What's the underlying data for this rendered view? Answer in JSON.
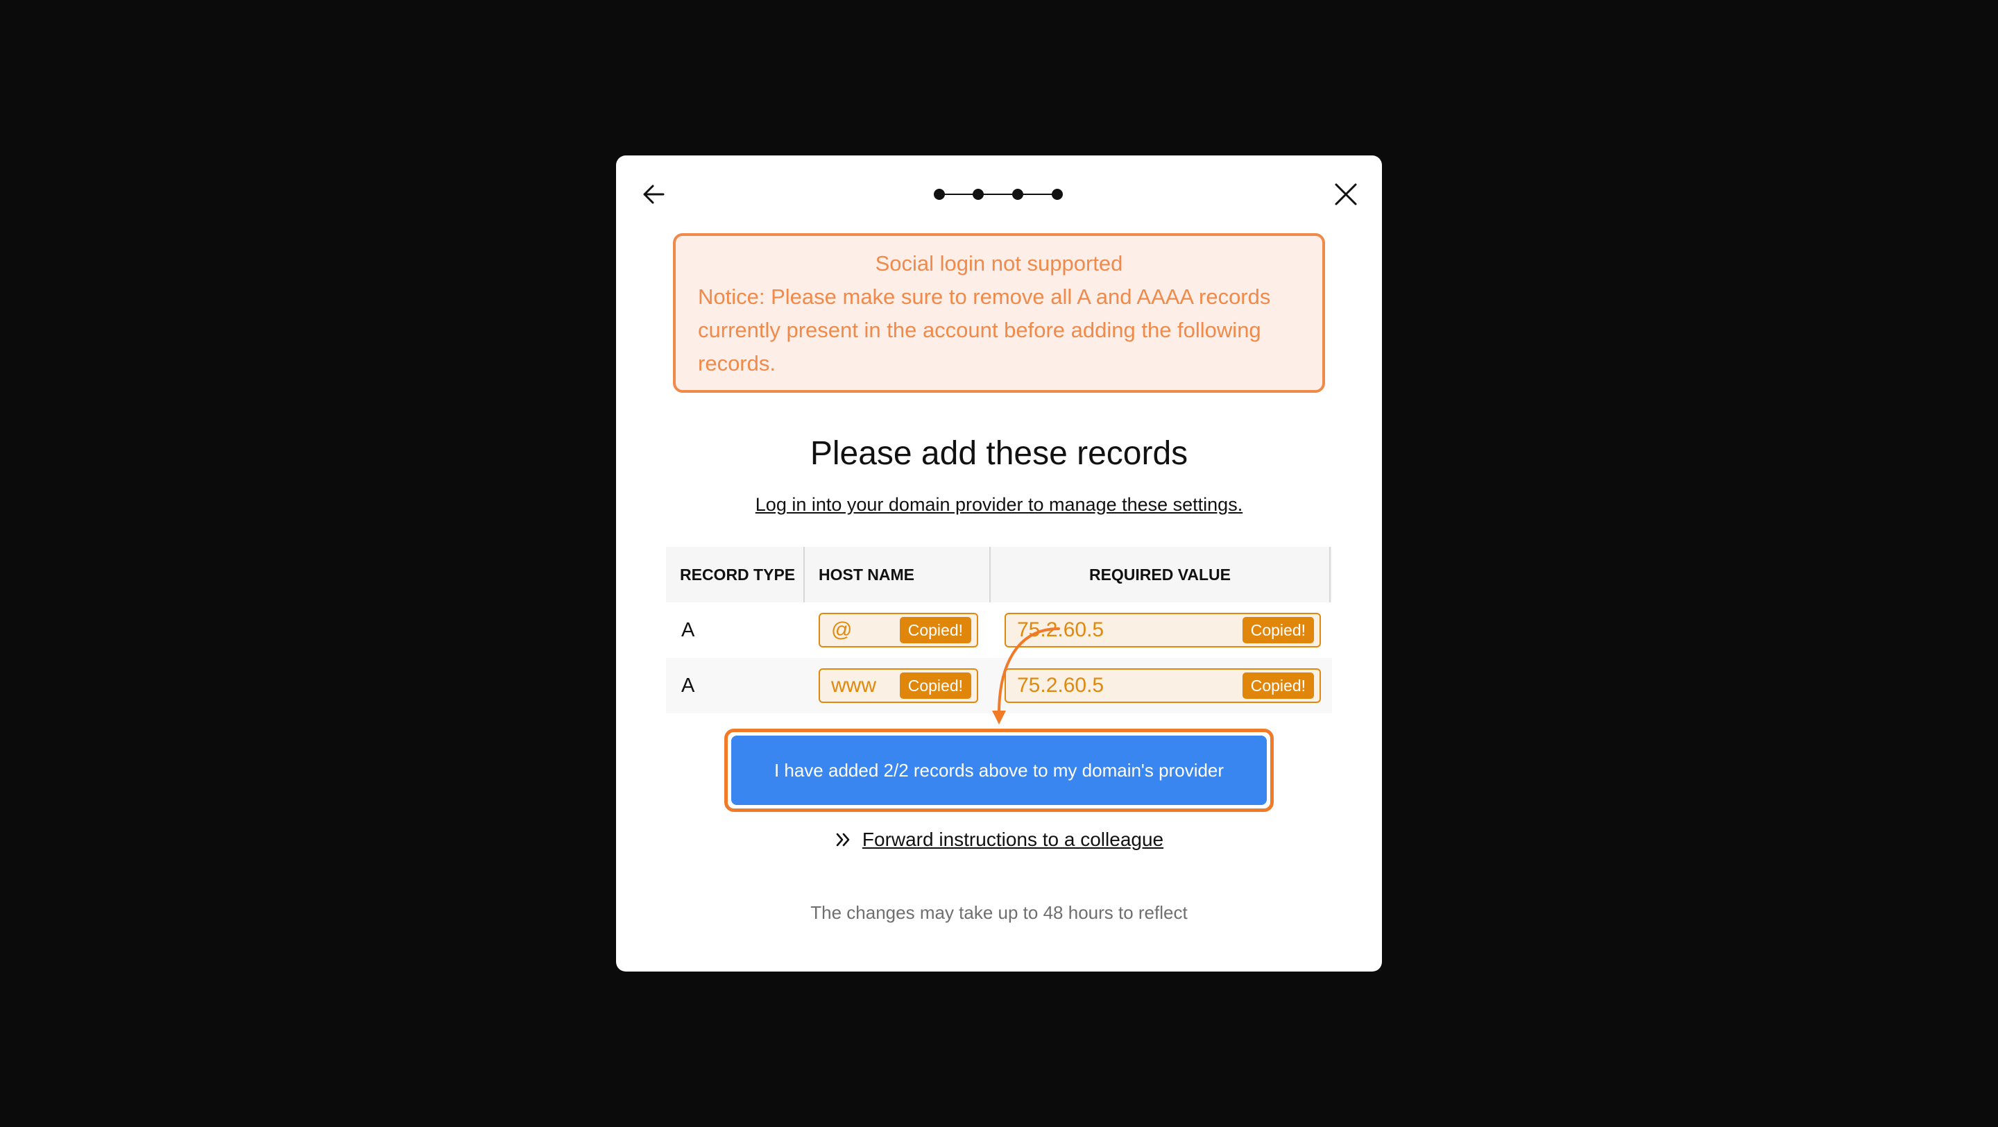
{
  "header": {
    "back_icon": "arrow-left-icon",
    "close_icon": "close-icon",
    "stepper_total": 4
  },
  "notice": {
    "title": "Social login not supported",
    "body": "Notice: Please make sure to remove all A and AAAA records currently present in the account before adding the following records.",
    "color": "#f08a4b",
    "background": "#fdeee7"
  },
  "main": {
    "heading": "Please add these records",
    "provider_link": "Log in into your domain provider to manage these settings."
  },
  "table": {
    "columns": [
      "RECORD TYPE",
      "HOST NAME",
      "REQUIRED VALUE"
    ],
    "rows": [
      {
        "type": "A",
        "host": "@",
        "host_badge": "Copied!",
        "value": "75.2.60.5",
        "value_badge": "Copied!"
      },
      {
        "type": "A",
        "host": "www",
        "host_badge": "Copied!",
        "value": "75.2.60.5",
        "value_badge": "Copied!"
      }
    ]
  },
  "actions": {
    "confirm_label": "I have added 2/2 records above to my domain's provider",
    "forward_icon": "double-chevron-right-icon",
    "forward_label": "Forward instructions to a colleague"
  },
  "footer": {
    "note": "The changes may take up to 48 hours to reflect"
  },
  "colors": {
    "page_background": "#0b0b0b",
    "accent_orange": "#e0890e",
    "highlight_orange": "#f07a28",
    "primary_blue": "#3a86f0"
  }
}
